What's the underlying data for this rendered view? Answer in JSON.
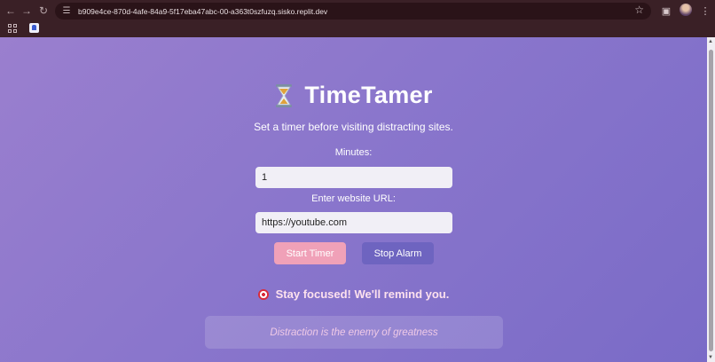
{
  "browser": {
    "url": "b909e4ce-870d-4afe-84a9-5f17eba47abc-00-a363t0szfuzq.sisko.replit.dev",
    "icons": {
      "back": "arrow-left-icon",
      "forward": "arrow-right-icon",
      "reload": "reload-icon",
      "site_info": "tune-icon",
      "bookmark": "star-icon",
      "extensions": "puzzle-icon",
      "menu": "kebab-menu-icon",
      "apps": "apps-grid-icon"
    }
  },
  "app": {
    "title": "TimeTamer",
    "title_icon": "hourglass-icon",
    "subtitle": "Set a timer before visiting distracting sites.",
    "minutes_label": "Minutes:",
    "minutes_value": "1",
    "url_label": "Enter website URL:",
    "url_value": "https://youtube.com",
    "start_label": "Start Timer",
    "stop_label": "Stop Alarm",
    "reminder_icon": "target-icon",
    "reminder": "Stay focused! We'll remind you.",
    "quote": "Distraction is the enemy of greatness"
  },
  "colors": {
    "background_start": "#9a7fce",
    "background_end": "#7a6bc7",
    "start_button": "#f0a1b8",
    "stop_button": "#6e64c0",
    "reminder_text": "#fde1ee",
    "quote_text": "#efc9e6"
  }
}
